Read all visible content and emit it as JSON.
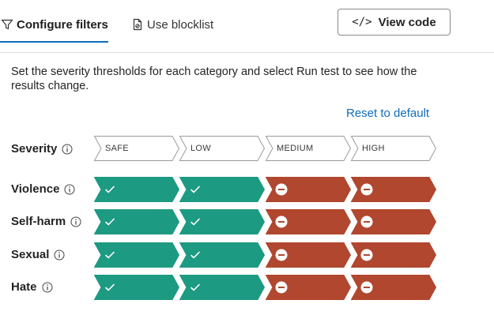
{
  "tabs": {
    "configure_label": "Configure filters",
    "blocklist_label": "Use blocklist"
  },
  "view_code_label": "View code",
  "description": "Set the severity thresholds for each category and select Run test to see how the results change.",
  "reset_label": "Reset to default",
  "severity": {
    "label": "Severity",
    "levels": [
      "SAFE",
      "LOW",
      "MEDIUM",
      "HIGH"
    ]
  },
  "categories": [
    {
      "label": "Violence",
      "states": [
        "allowed",
        "allowed",
        "blocked",
        "blocked"
      ]
    },
    {
      "label": "Self-harm",
      "states": [
        "allowed",
        "allowed",
        "blocked",
        "blocked"
      ]
    },
    {
      "label": "Sexual",
      "states": [
        "allowed",
        "allowed",
        "blocked",
        "blocked"
      ]
    },
    {
      "label": "Hate",
      "states": [
        "allowed",
        "allowed",
        "blocked",
        "blocked"
      ]
    }
  ],
  "colors": {
    "allowed": "#1d9a82",
    "blocked": "#b0472e",
    "accent": "#0f6cbd"
  },
  "icons": {
    "configure_tab": "filter-icon",
    "blocklist_tab": "document-icon",
    "view_code": "code-icon",
    "info": "info-icon",
    "allowed": "checkmark-icon",
    "blocked": "blocked-icon"
  }
}
